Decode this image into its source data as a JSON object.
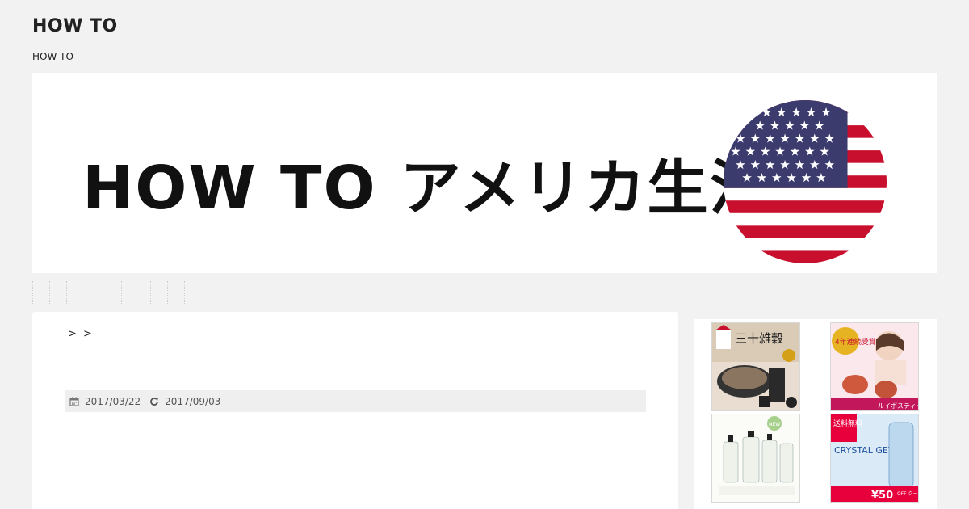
{
  "site": {
    "title": "HOW TO",
    "description": "HOW TO"
  },
  "banner": {
    "text": "HOW TO アメリカ生活",
    "flag_icon": "us-flag-icon"
  },
  "nav": {
    "items": [
      "",
      "",
      "",
      "",
      "",
      "",
      ""
    ]
  },
  "article": {
    "breadcrumb": "> >",
    "published": "2017/03/22",
    "updated": "2017/09/03",
    "published_icon": "calendar-icon",
    "updated_icon": "refresh-icon"
  },
  "sidebar": {
    "ads": [
      {
        "heading": "三十雑穀",
        "kind": "grain-product-ad"
      },
      {
        "heading": "4年連続受賞",
        "subheading": "ルイボスティー",
        "kind": "tea-product-ad"
      },
      {
        "heading": "NEW",
        "kind": "shampoo-product-ad"
      },
      {
        "heading": "送料無料",
        "subheading": "CRYSTAL GEYSER",
        "price": "¥50",
        "tag": "OFF クーポン",
        "kind": "water-product-ad"
      }
    ]
  },
  "colors": {
    "background": "#f2f2f2",
    "flag_red": "#c8102e",
    "flag_blue": "#3c3b6e",
    "coupon_red": "#e8003c"
  }
}
